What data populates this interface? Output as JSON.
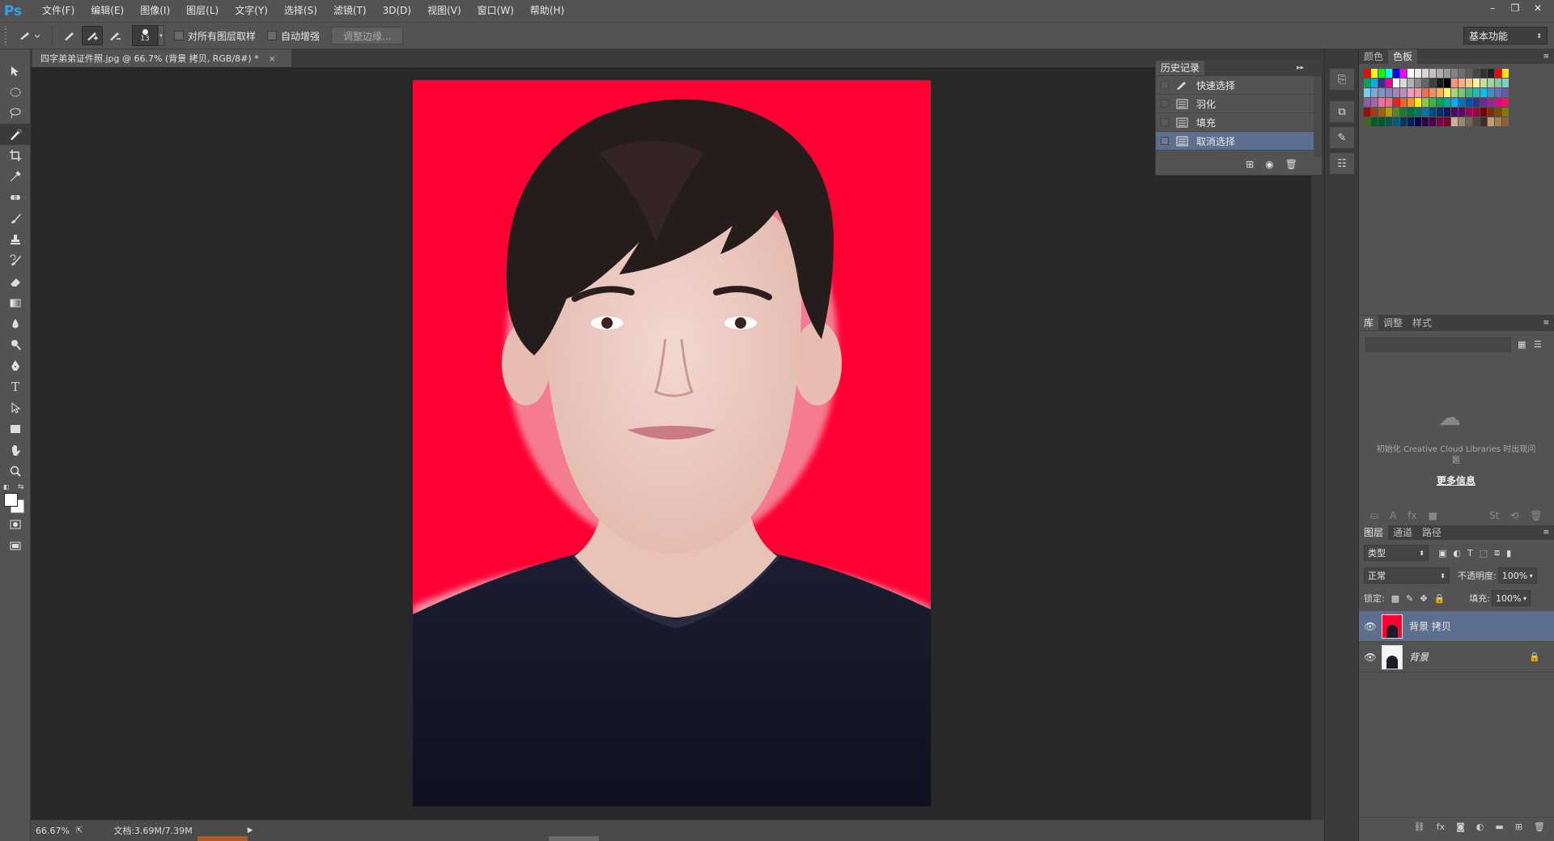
{
  "app": {
    "logo": "Ps"
  },
  "menu": [
    "文件(F)",
    "编辑(E)",
    "图像(I)",
    "图层(L)",
    "文字(Y)",
    "选择(S)",
    "滤镜(T)",
    "3D(D)",
    "视图(V)",
    "窗口(W)",
    "帮助(H)"
  ],
  "window_controls": {
    "minimize": "–",
    "restore": "❐",
    "close": "✕"
  },
  "options": {
    "brush_size": "13",
    "sample_all_layers": "对所有图层取样",
    "auto_enhance": "自动增强",
    "refine_edge": "调整边缘...",
    "workspace": "基本功能"
  },
  "document": {
    "tab_title": "四字弟弟证件照.jpg @ 66.7% (背景 拷贝, RGB/8#) *",
    "tab_close": "×"
  },
  "status": {
    "zoom": "66.67%",
    "doc_size": "文档:3.69M/7.39M"
  },
  "history": {
    "tab": "历史记录",
    "items": [
      {
        "label": "快速选择",
        "icon": "quick-select-icon"
      },
      {
        "label": "羽化",
        "icon": "history-step-icon"
      },
      {
        "label": "填充",
        "icon": "history-step-icon"
      },
      {
        "label": "取消选择",
        "icon": "history-step-icon"
      }
    ]
  },
  "color_panel": {
    "tabs": [
      "颜色",
      "色板"
    ]
  },
  "swatch_colors": [
    [
      "#ff0000",
      "#ffff00",
      "#00ff00",
      "#00ffff",
      "#0000ff",
      "#ff00ff",
      "#ffffff",
      "#ebebeb",
      "#d6d6d6",
      "#c2c2c2",
      "#adadad",
      "#999999",
      "#858585",
      "#707070",
      "#5c5c5c",
      "#474747",
      "#333333",
      "#1f1f1f",
      "#ff0000",
      "#ffe600"
    ],
    [
      "#00a651",
      "#00aeef",
      "#2e3192",
      "#ec008c",
      "#ffffff",
      "#d9d9d9",
      "#b3b3b3",
      "#8c8c8c",
      "#666666",
      "#404040",
      "#1a1a1a",
      "#000000",
      "#f7977a",
      "#f9ad81",
      "#fdc68a",
      "#fff79a",
      "#c4df9b",
      "#a3d39c",
      "#82ca9d",
      "#7bcdc8"
    ],
    [
      "#6ecff6",
      "#7ea7d8",
      "#8493ca",
      "#8882be",
      "#a187be",
      "#bc8dbf",
      "#f49ac2",
      "#f6989d",
      "#f26c4f",
      "#f68e55",
      "#fbaf5c",
      "#fff467",
      "#acd372",
      "#7cc576",
      "#3bb878",
      "#1abbb4",
      "#00bff3",
      "#438cca",
      "#5574b9",
      "#605ca8"
    ],
    [
      "#855fa8",
      "#a763a8",
      "#f06eaa",
      "#f26d7d",
      "#ed1c24",
      "#f26522",
      "#f7941d",
      "#fff200",
      "#8dc73f",
      "#39b54a",
      "#00a651",
      "#00a99d",
      "#00aeef",
      "#0072bc",
      "#0054a6",
      "#2e3192",
      "#662d91",
      "#92278f",
      "#ec008c",
      "#ed145b"
    ],
    [
      "#9e0b0f",
      "#a0410d",
      "#a3620a",
      "#aba000",
      "#598527",
      "#1a7b30",
      "#007236",
      "#00746b",
      "#0076a3",
      "#004b80",
      "#003471",
      "#1b1464",
      "#440e62",
      "#630460",
      "#9e005d",
      "#9e0039",
      "#790000",
      "#7b2e00",
      "#7d4900",
      "#827b00"
    ],
    [
      "#406618",
      "#005e20",
      "#005826",
      "#005952",
      "#005b7f",
      "#003663",
      "#002157",
      "#0d004c",
      "#32004b",
      "#4b0049",
      "#7b0046",
      "#7a0026",
      "#c7b299",
      "#998675",
      "#736357",
      "#534741",
      "#37302d",
      "#c69c6d",
      "#a67c52",
      "#8c6239"
    ]
  ],
  "libraries": {
    "tabs": [
      "库",
      "调整",
      "样式"
    ],
    "message": "初始化 Creative Cloud Libraries 时出现问题",
    "more_info": "更多信息"
  },
  "layers": {
    "tabs": [
      "图层",
      "通道",
      "路径"
    ],
    "filter_kind": "类型",
    "blend_mode": "正常",
    "opacity_label": "不透明度:",
    "opacity": "100%",
    "lock_label": "锁定:",
    "fill_label": "填充:",
    "fill": "100%",
    "items": [
      {
        "name": "背景 拷贝",
        "selected": true,
        "locked": false
      },
      {
        "name": "背景",
        "selected": false,
        "locked": true
      }
    ]
  }
}
